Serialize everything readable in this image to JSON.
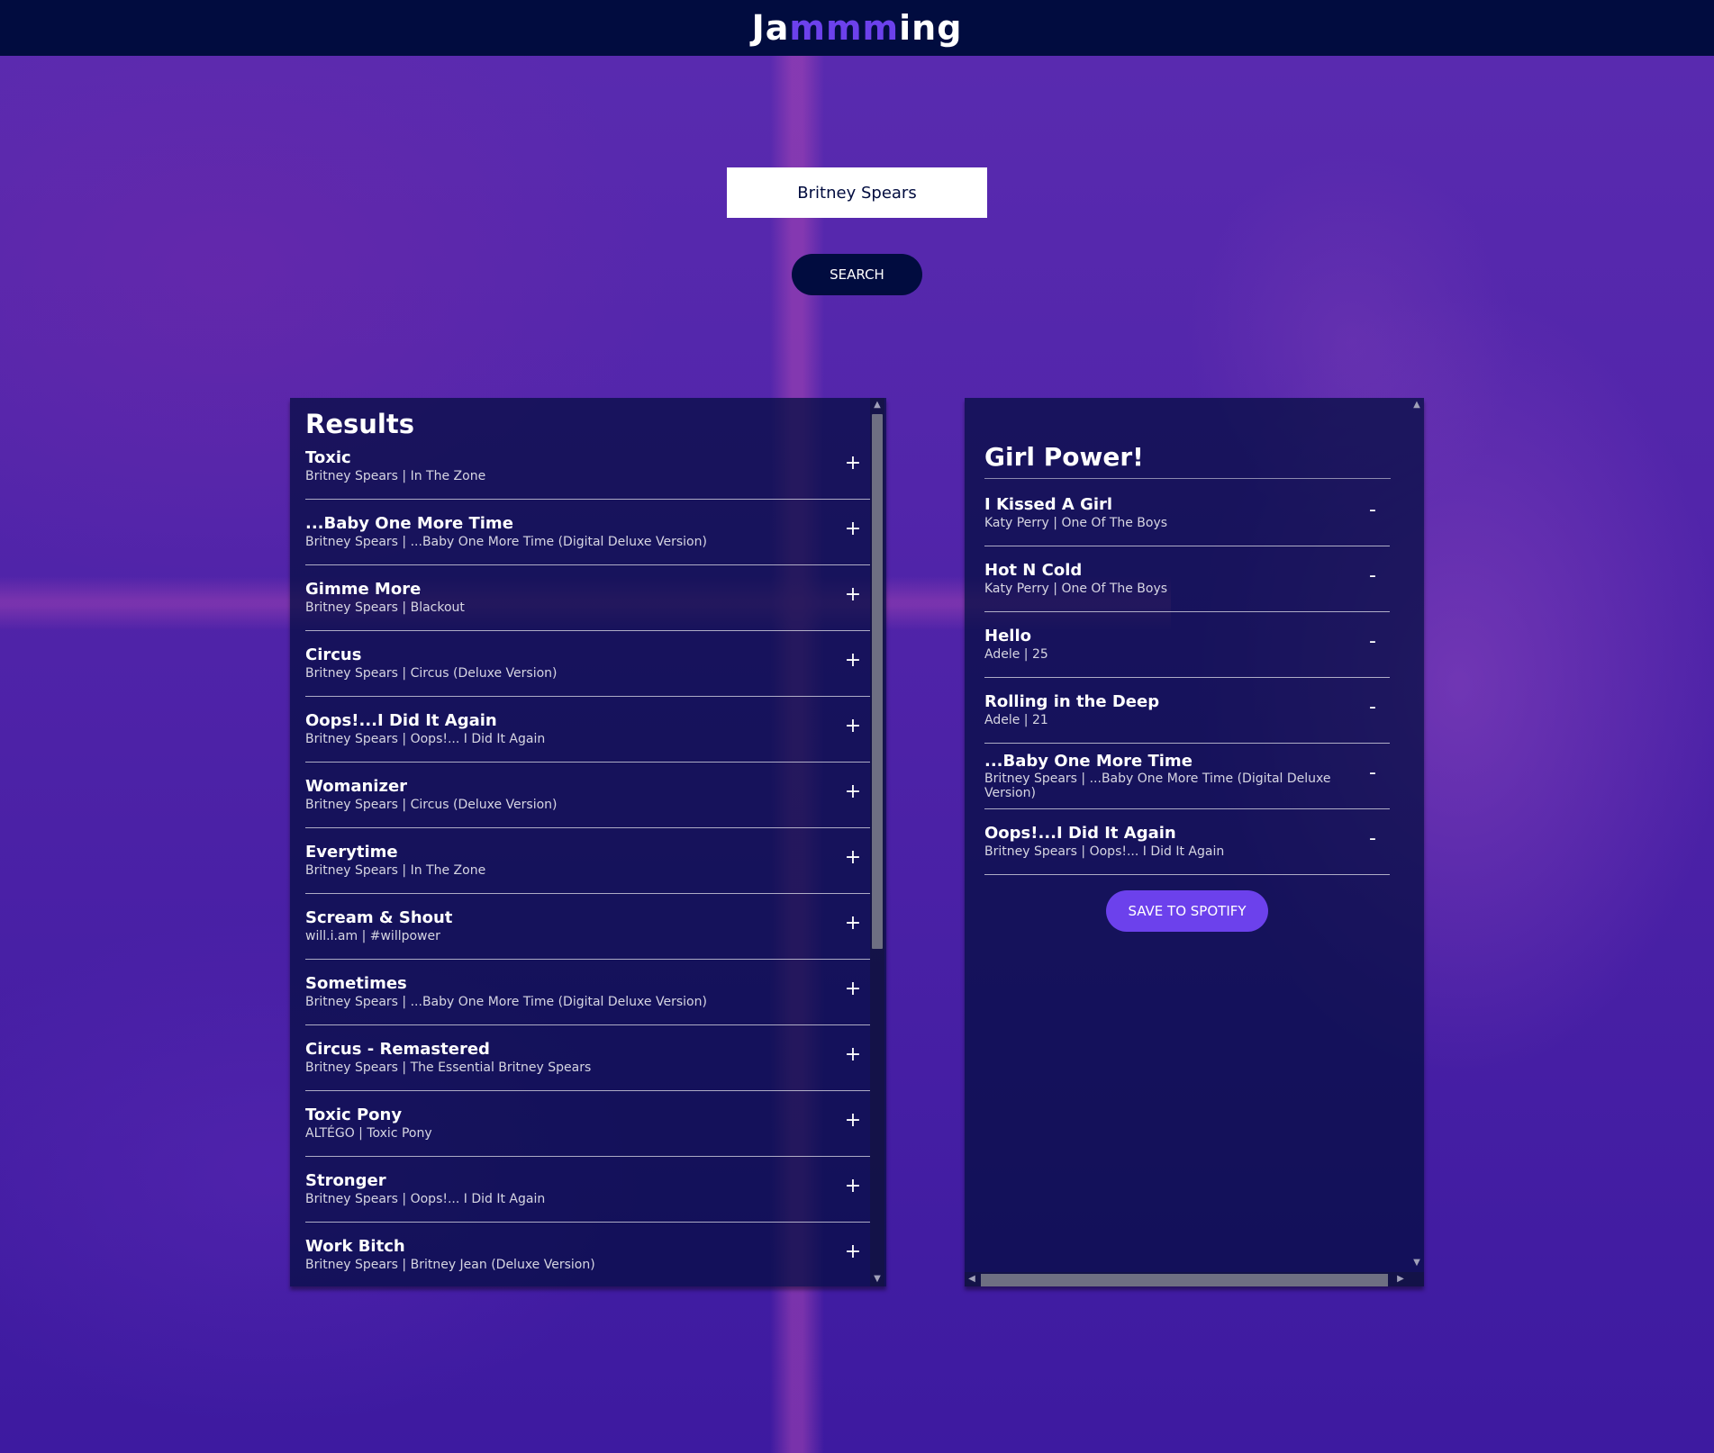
{
  "header": {
    "logo_part1": "Ja",
    "logo_part2": "mmm",
    "logo_part3": "ing"
  },
  "search": {
    "value": "Britney Spears",
    "button_label": "SEARCH"
  },
  "results": {
    "title": "Results",
    "action_symbol": "+",
    "tracks": [
      {
        "name": "Toxic",
        "info": "Britney Spears | In The Zone"
      },
      {
        "name": "...Baby One More Time",
        "info": "Britney Spears | ...Baby One More Time (Digital Deluxe Version)"
      },
      {
        "name": "Gimme More",
        "info": "Britney Spears | Blackout"
      },
      {
        "name": "Circus",
        "info": "Britney Spears | Circus (Deluxe Version)"
      },
      {
        "name": "Oops!...I Did It Again",
        "info": "Britney Spears | Oops!... I Did It Again"
      },
      {
        "name": "Womanizer",
        "info": "Britney Spears | Circus (Deluxe Version)"
      },
      {
        "name": "Everytime",
        "info": "Britney Spears | In The Zone"
      },
      {
        "name": "Scream & Shout",
        "info": "will.i.am | #willpower"
      },
      {
        "name": "Sometimes",
        "info": "Britney Spears | ...Baby One More Time (Digital Deluxe Version)"
      },
      {
        "name": "Circus - Remastered",
        "info": "Britney Spears | The Essential Britney Spears"
      },
      {
        "name": "Toxic Pony",
        "info": "ALTÉGO | Toxic Pony"
      },
      {
        "name": "Stronger",
        "info": "Britney Spears | Oops!... I Did It Again"
      },
      {
        "name": "Work Bitch",
        "info": "Britney Spears | Britney Jean (Deluxe Version)"
      }
    ]
  },
  "playlist": {
    "name": "Girl Power!",
    "action_symbol": "-",
    "save_label": "SAVE TO SPOTIFY",
    "tracks": [
      {
        "name": "I Kissed A Girl",
        "info": "Katy Perry | One Of The Boys"
      },
      {
        "name": "Hot N Cold",
        "info": "Katy Perry | One Of The Boys"
      },
      {
        "name": "Hello",
        "info": "Adele | 25"
      },
      {
        "name": "Rolling in the Deep",
        "info": "Adele | 21"
      },
      {
        "name": "...Baby One More Time",
        "info_line1": "Britney Spears | ...Baby One More Time (Digital Deluxe",
        "info_line2": "Version)"
      },
      {
        "name": "Oops!...I Did It Again",
        "info": "Britney Spears | Oops!... I Did It Again"
      }
    ]
  },
  "colors": {
    "header_bg": "#010c3f",
    "accent": "#6c41ec",
    "panel_bg": "rgba(1,12,63,0.72)"
  },
  "icons": {
    "scroll_up": "chevron-up-icon",
    "scroll_down": "chevron-down-icon",
    "scroll_left": "chevron-left-icon",
    "scroll_right": "chevron-right-icon"
  }
}
